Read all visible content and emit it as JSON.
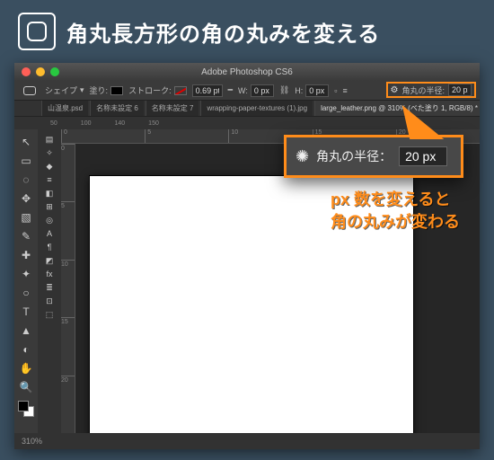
{
  "header": {
    "title": "角丸長方形の角の丸みを変える"
  },
  "window": {
    "title": "Adobe Photoshop CS6"
  },
  "optionsBar": {
    "shapeLabel": "シェイプ",
    "fillLabel": "塗り:",
    "strokeLabel": "ストローク:",
    "strokeWidth": "0.69 pt",
    "wLabel": "W:",
    "wValue": "0 px",
    "hLabel": "H:",
    "hValue": "0 px",
    "radiusLabel": "角丸の半径:",
    "radiusValue": "20 px"
  },
  "tabs": [
    "山温泉.psd",
    "名称未設定 6",
    "名称未設定 7",
    "wrapping-paper-textures (1).jpg",
    "large_leather.png @ 310% (べた塗り 1, RGB/8) *"
  ],
  "activeTab": 4,
  "info": [
    "50",
    "100",
    "140",
    "150"
  ],
  "rulerTop": [
    "0",
    "5",
    "10",
    "15",
    "20"
  ],
  "rulerLeft": [
    "0",
    "5",
    "10",
    "15",
    "20"
  ],
  "status": {
    "zoom": "310%"
  },
  "callout": {
    "label": "角丸の半径：",
    "value": "20 px",
    "note1": "px 数を変えると",
    "note2": "角の丸みが変わる"
  },
  "tools": [
    "↖",
    "▭",
    "◌",
    "✥",
    "▧",
    "✎",
    "✚",
    "✦",
    "○",
    "T",
    "▲",
    "◐",
    "✋",
    "🔍"
  ]
}
